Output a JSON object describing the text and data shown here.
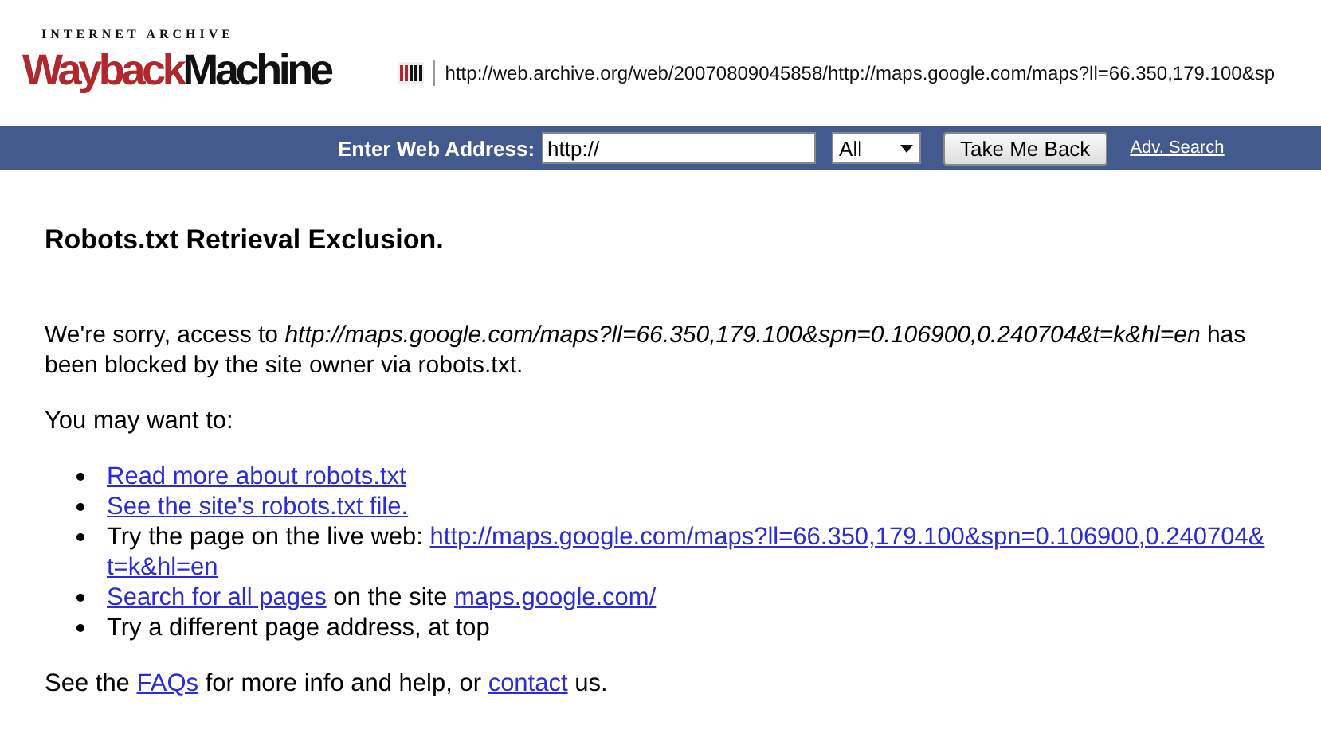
{
  "header": {
    "logo": {
      "top": "INTERNET ARCHIVE",
      "first": "Wayback",
      "second": "Machine"
    },
    "archived_url": "http://web.archive.org/web/20070809045858/http://maps.google.com/maps?ll=66.350,179.100&sp"
  },
  "search_bar": {
    "label": "Enter Web Address:",
    "value": "http://",
    "scope": "All",
    "button": "Take Me Back",
    "link": "Adv. Search"
  },
  "heading": "Robots.txt Retrieval Exclusion.",
  "message": "We're sorry, access to *http://maps.google.com/maps?ll=66.350,179.100&spn=0.106900,0.240704&t=k&hl=en* has been blocked by the site owner via robots.txt.",
  "intro": "You may want to:",
  "options": [
    {
      "segments": [
        {
          "kind": "link",
          "lines": [
            "Read more about robots.txt"
          ]
        }
      ]
    },
    {
      "segments": [
        {
          "kind": "link",
          "lines": [
            "See the site's robots.txt file."
          ]
        }
      ]
    },
    {
      "segments": [
        {
          "kind": "text",
          "text": "Try the page on the live web: "
        },
        {
          "kind": "link",
          "lines": [
            "http://maps.google.com/maps?ll=66.350,179.100&spn=0.106900,0.240704&",
            "t=k&hl=en"
          ]
        }
      ]
    },
    {
      "segments": [
        {
          "kind": "link",
          "lines": [
            "Search for all pages"
          ]
        },
        {
          "kind": "text",
          "text": " on the site "
        },
        {
          "kind": "link",
          "lines": [
            "maps.google.com/"
          ]
        }
      ]
    },
    {
      "segments": [
        {
          "kind": "text",
          "text": "Try a different page address, at top"
        }
      ]
    }
  ],
  "footer": {
    "segments": [
      {
        "kind": "text",
        "text": "See the "
      },
      {
        "kind": "link",
        "lines": [
          "FAQs"
        ]
      },
      {
        "kind": "text",
        "text": " for more info and help, or "
      },
      {
        "kind": "link",
        "lines": [
          "contact"
        ]
      },
      {
        "kind": "text",
        "text": " us."
      }
    ]
  }
}
